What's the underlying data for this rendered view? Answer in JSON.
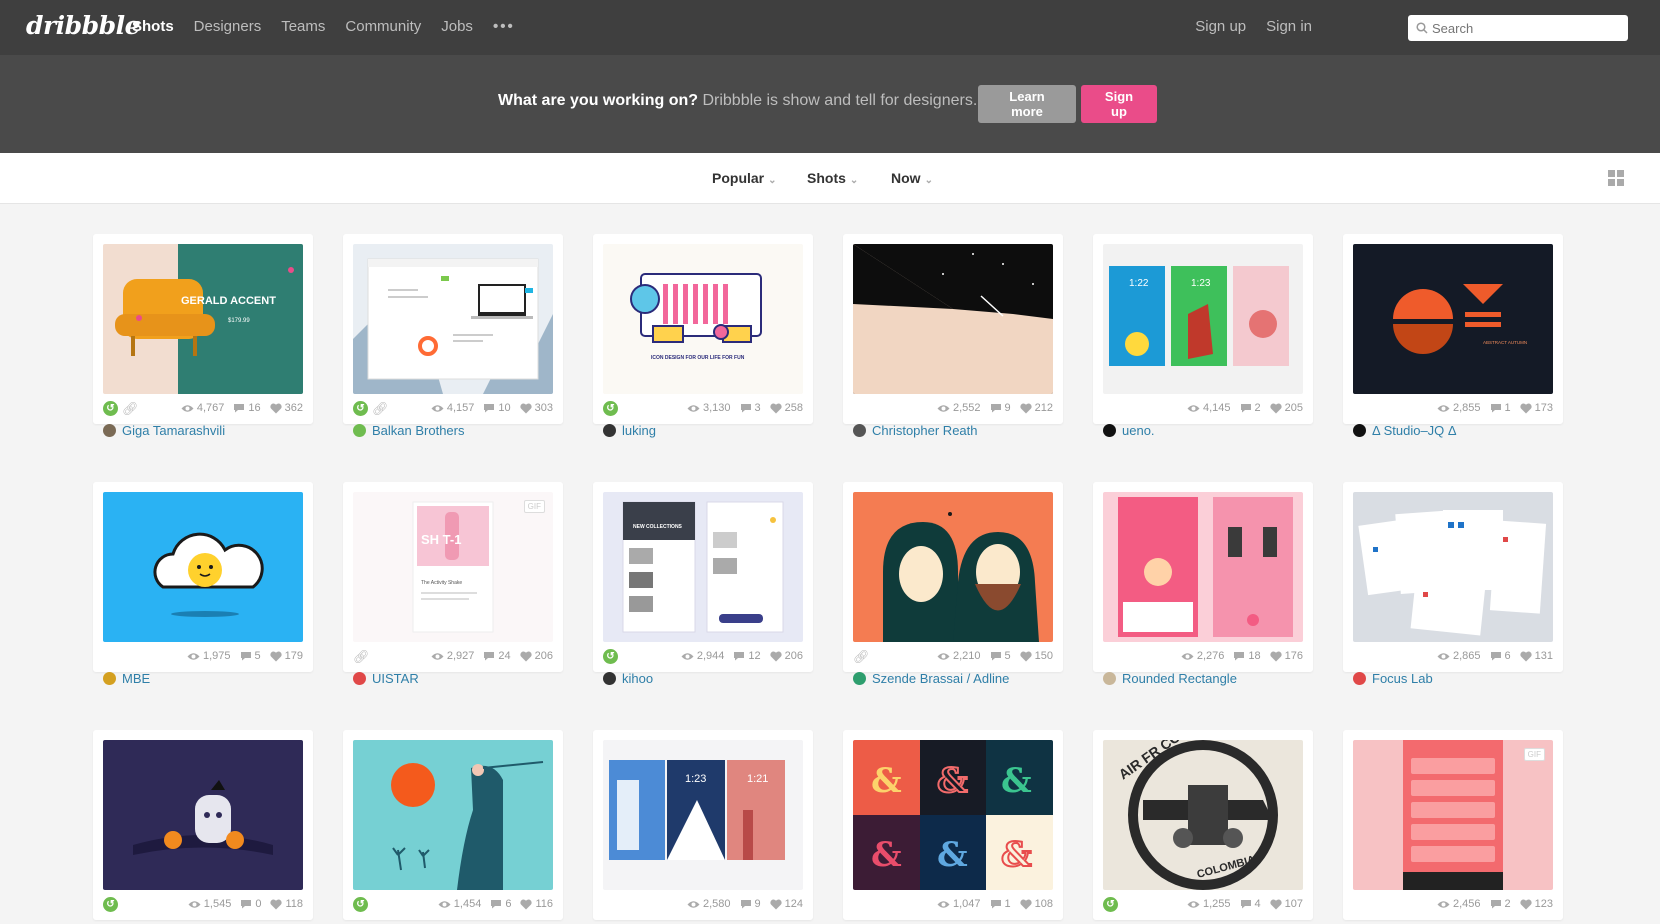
{
  "header": {
    "logo": "dribbble",
    "nav": [
      "Shots",
      "Designers",
      "Teams",
      "Community",
      "Jobs"
    ],
    "more": "•••",
    "signup": "Sign up",
    "signin": "Sign in",
    "search_placeholder": "Search"
  },
  "promo": {
    "question": "What are you working on?",
    "tagline": "Dribbble is show and tell for designers.",
    "learn_more": "Learn more",
    "signup": "Sign up"
  },
  "filters": [
    "Popular",
    "Shots",
    "Now"
  ],
  "shots": [
    {
      "views": "4,767",
      "comments": "16",
      "likes": "362",
      "author": "Giga Tamarashvili",
      "rebound": true,
      "link": true,
      "avatar": "#7a6a55"
    },
    {
      "views": "4,157",
      "comments": "10",
      "likes": "303",
      "author": "Balkan Brothers",
      "rebound": true,
      "link": true,
      "avatar": "#6fbc4f"
    },
    {
      "views": "3,130",
      "comments": "3",
      "likes": "258",
      "author": "luking",
      "rebound": true,
      "link": false,
      "avatar": "#333333"
    },
    {
      "views": "2,552",
      "comments": "9",
      "likes": "212",
      "author": "Christopher Reath",
      "rebound": false,
      "link": false,
      "avatar": "#555555"
    },
    {
      "views": "4,145",
      "comments": "2",
      "likes": "205",
      "author": "ueno.",
      "rebound": false,
      "link": false,
      "avatar": "#111111"
    },
    {
      "views": "2,855",
      "comments": "1",
      "likes": "173",
      "author": "Δ Studio–JQ Δ",
      "rebound": false,
      "link": false,
      "avatar": "#111111"
    },
    {
      "views": "1,975",
      "comments": "5",
      "likes": "179",
      "author": "MBE",
      "rebound": false,
      "link": false,
      "avatar": "#d4a020"
    },
    {
      "views": "2,927",
      "comments": "24",
      "likes": "206",
      "author": "UISTAR",
      "rebound": false,
      "link": true,
      "avatar": "#e04848",
      "gif": "GIF"
    },
    {
      "views": "2,944",
      "comments": "12",
      "likes": "206",
      "author": "kihoo",
      "rebound": true,
      "link": false,
      "avatar": "#333333"
    },
    {
      "views": "2,210",
      "comments": "5",
      "likes": "150",
      "author": "Szende Brassai / Adline",
      "rebound": false,
      "link": true,
      "avatar": "#2e9e6e"
    },
    {
      "views": "2,276",
      "comments": "18",
      "likes": "176",
      "author": "Rounded Rectangle",
      "rebound": false,
      "link": false,
      "avatar": "#c9b79a"
    },
    {
      "views": "2,865",
      "comments": "6",
      "likes": "131",
      "author": "Focus Lab",
      "rebound": false,
      "link": false,
      "avatar": "#e04848"
    },
    {
      "views": "1,545",
      "comments": "0",
      "likes": "118",
      "author": "",
      "rebound": true,
      "link": false,
      "avatar": ""
    },
    {
      "views": "1,454",
      "comments": "6",
      "likes": "116",
      "author": "",
      "rebound": true,
      "link": false,
      "avatar": ""
    },
    {
      "views": "2,580",
      "comments": "9",
      "likes": "124",
      "author": "",
      "rebound": false,
      "link": false,
      "avatar": ""
    },
    {
      "views": "1,047",
      "comments": "1",
      "likes": "108",
      "author": "",
      "rebound": false,
      "link": false,
      "avatar": ""
    },
    {
      "views": "1,255",
      "comments": "4",
      "likes": "107",
      "author": "",
      "rebound": true,
      "link": false,
      "avatar": ""
    },
    {
      "views": "2,456",
      "comments": "2",
      "likes": "123",
      "author": "",
      "rebound": false,
      "link": false,
      "avatar": "",
      "gif": "GIF"
    }
  ],
  "thumb_text": {
    "t0_title": "GERALD ACCENT",
    "t0_price": "$179.99",
    "t2_caption": "ICON DESIGN FOR OUR LIFE FOR FUN",
    "t4_time1": "1:22",
    "t4_time2": "1:23",
    "t5_caption": "ABSTRACT AUTUMN",
    "t7_big": "SH T-1",
    "t7_small": "The Activity Shake",
    "t8_new": "NEW COLLECTIONS",
    "t14_time1": "1:23",
    "t14_time2": "1:21",
    "t16_coffee": "AIR FR COFFEE",
    "t16_country": "COLOMBIA"
  }
}
